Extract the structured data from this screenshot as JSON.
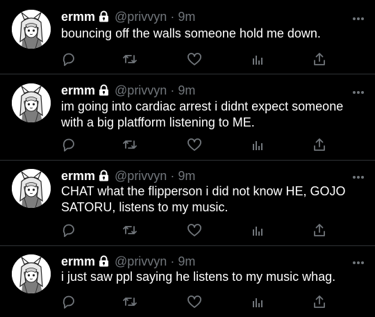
{
  "colors": {
    "background": "#000000",
    "text": "#ffffff",
    "muted": "#71767b",
    "divider": "#2f3336"
  },
  "tweets": [
    {
      "display_name": "ermm",
      "handle": "@privvyn",
      "separator": "·",
      "time": "9m",
      "text": "bouncing off the walls someone hold me down.",
      "icons": [
        "lock-icon",
        "more-icon",
        "reply-icon",
        "retweet-icon",
        "like-icon",
        "analytics-icon",
        "share-icon"
      ]
    },
    {
      "display_name": "ermm",
      "handle": "@privvyn",
      "separator": "·",
      "time": "9m",
      "text": "im going into cardiac arrest i didnt expect someone with a big platfform listening to ME.",
      "icons": [
        "lock-icon",
        "more-icon",
        "reply-icon",
        "retweet-icon",
        "like-icon",
        "analytics-icon",
        "share-icon"
      ]
    },
    {
      "display_name": "ermm",
      "handle": "@privvyn",
      "separator": "·",
      "time": "9m",
      "text": "CHAT what the flipperson i did not know HE, GOJO SATORU, listens to my music.",
      "icons": [
        "lock-icon",
        "more-icon",
        "reply-icon",
        "retweet-icon",
        "like-icon",
        "analytics-icon",
        "share-icon"
      ]
    },
    {
      "display_name": "ermm",
      "handle": "@privvyn",
      "separator": "·",
      "time": "9m",
      "text": "i just saw ppl saying he listens to my music whag.",
      "icons": [
        "lock-icon",
        "more-icon",
        "reply-icon",
        "retweet-icon",
        "like-icon",
        "analytics-icon",
        "share-icon"
      ]
    }
  ]
}
